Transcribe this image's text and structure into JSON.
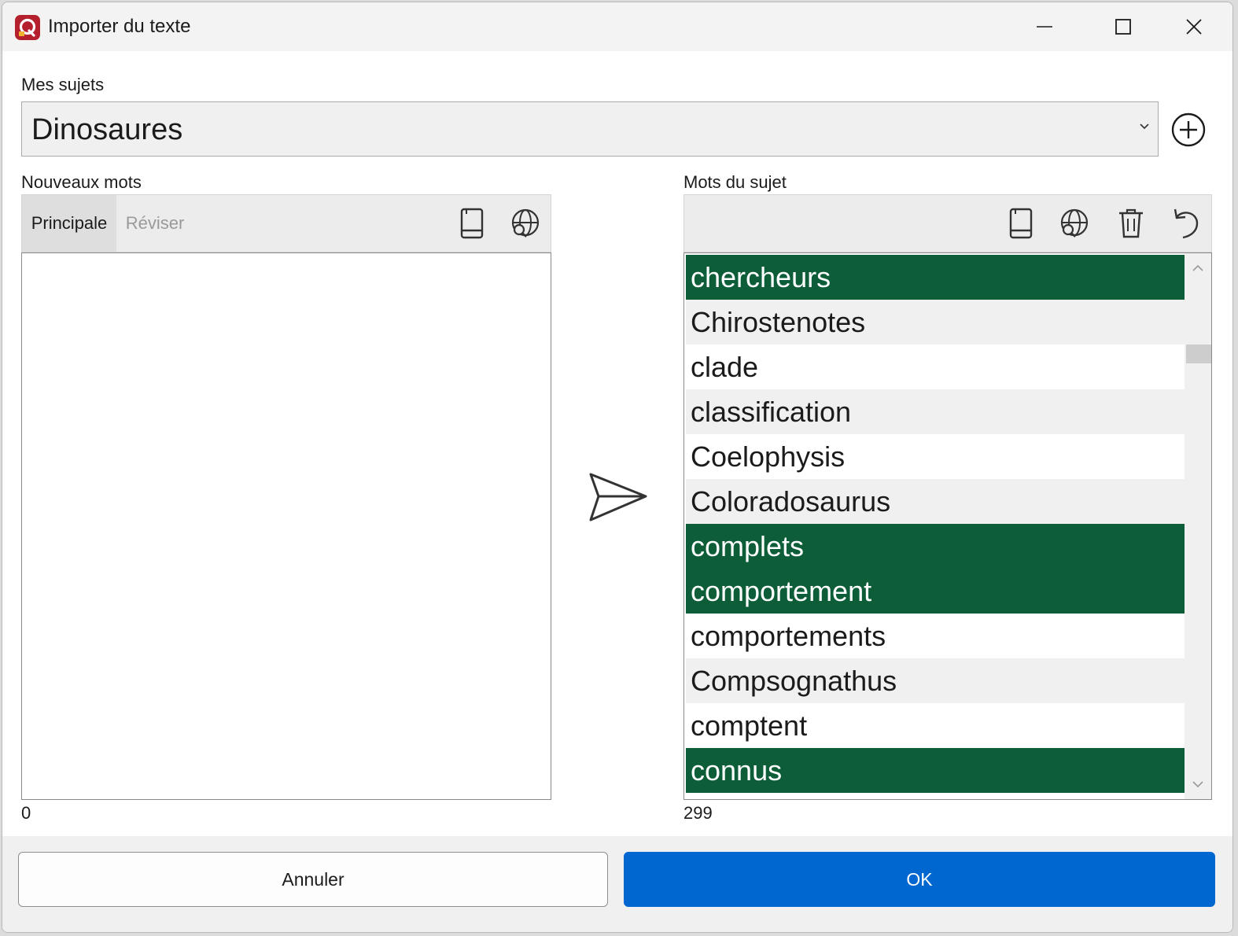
{
  "window": {
    "title": "Importer du texte",
    "app_icon": "app-logo-icon",
    "controls": [
      "minimize-icon",
      "maximize-icon",
      "close-icon"
    ]
  },
  "subjects": {
    "label": "Mes sujets",
    "selected": "Dinosaures",
    "add_icon": "plus-circle-icon"
  },
  "new_words": {
    "label": "Nouveaux mots",
    "tabs": [
      {
        "label": "Principale",
        "active": true
      },
      {
        "label": "Réviser",
        "active": false
      }
    ],
    "tools": [
      "book-icon",
      "web-search-icon"
    ],
    "text": "",
    "count": "0"
  },
  "transfer_icon": "send-arrow-icon",
  "subject_words": {
    "label": "Mots du sujet",
    "tools": [
      "book-icon",
      "web-search-icon",
      "trash-icon",
      "undo-icon"
    ],
    "items": [
      {
        "text": "chercheurs",
        "selected": true
      },
      {
        "text": "Chirostenotes",
        "selected": false
      },
      {
        "text": "clade",
        "selected": false
      },
      {
        "text": "classification",
        "selected": false
      },
      {
        "text": "Coelophysis",
        "selected": false
      },
      {
        "text": "Coloradosaurus",
        "selected": false
      },
      {
        "text": "complets",
        "selected": true
      },
      {
        "text": "comportement",
        "selected": true
      },
      {
        "text": "comportements",
        "selected": false
      },
      {
        "text": "Compsognathus",
        "selected": false
      },
      {
        "text": "comptent",
        "selected": false
      },
      {
        "text": "connus",
        "selected": true
      }
    ],
    "count": "299"
  },
  "colors": {
    "selected_row": "#0d5e38",
    "primary_button": "#0067d1",
    "app_icon": "#b5202e"
  },
  "footer": {
    "cancel_label": "Annuler",
    "ok_label": "OK"
  }
}
